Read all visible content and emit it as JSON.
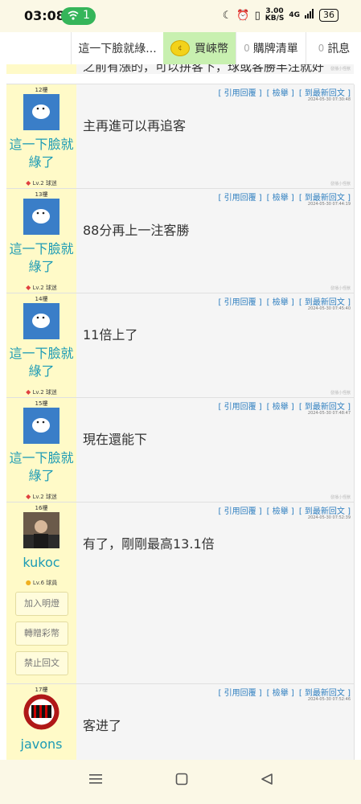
{
  "status_bar": {
    "time": "03:08",
    "hotspot_count": "1",
    "network_speed_value": "3.00",
    "network_speed_unit": "KB/S",
    "network_type": "4G",
    "battery": "36"
  },
  "topnav": {
    "thread_title": "這一下臉就綠...",
    "buy_coins": "買崍幣",
    "cart_count": "0",
    "cart_label": "購牌清單",
    "msg_count": "0",
    "msg_label": "訊息"
  },
  "prev_post_text": "之前有漲的，可以拼客下，球或客勝丰注就好",
  "post_actions": {
    "quote": "[ 引用回覆 ]",
    "report": "[ 檢舉 ]",
    "latest": "[ 到最新回文 ]"
  },
  "signature": "發播小怪獸",
  "posts": [
    {
      "floor": "12樓",
      "username": "這一下臉就綠了",
      "level": "Lv.2 球迷",
      "date": "2024-05-30 07:30:48",
      "message": "主再進可以再追客"
    },
    {
      "floor": "13樓",
      "username": "這一下臉就綠了",
      "level": "Lv.2 球迷",
      "date": "2024-05-30 07:44:19",
      "message": "88分再上一注客勝"
    },
    {
      "floor": "14樓",
      "username": "這一下臉就綠了",
      "level": "Lv.2 球迷",
      "date": "2024-05-30 07:45:40",
      "message": "11倍上了"
    },
    {
      "floor": "15樓",
      "username": "這一下臉就綠了",
      "level": "Lv.2 球迷",
      "date": "2024-05-30 07:48:47",
      "message": "現在還能下"
    },
    {
      "floor": "16樓",
      "username": "kukoc",
      "level": "Lv.6 球員",
      "date": "2024-05-30 07:52:39",
      "message": "有了，剛剛最高13.1倍"
    },
    {
      "floor": "17樓",
      "username": "javons",
      "level": "",
      "date": "2024-05-30 07:52:46",
      "message": "客进了"
    }
  ],
  "side_buttons": {
    "add_friend": "加入明燈",
    "gift": "轉贈彩幣",
    "ban": "禁止回文"
  },
  "colors": {
    "side_bg": "#fffac8",
    "username": "#1c9bb5",
    "action_link": "#2f7fc0",
    "active_tab": "#c8f0b0"
  }
}
